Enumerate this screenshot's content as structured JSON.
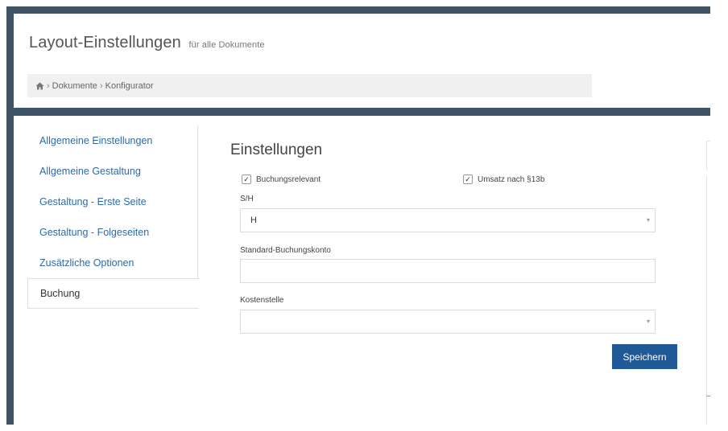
{
  "header": {
    "title": "Layout-Einstellungen",
    "subtitle": "für alle Dokumente",
    "breadcrumb": {
      "home_icon": "home-icon",
      "separator": "›",
      "items": [
        "Dokumente",
        "Konfigurator"
      ]
    }
  },
  "sidebar": {
    "items": [
      {
        "label": "Allgemeine Einstellungen"
      },
      {
        "label": "Allgemeine Gestaltung"
      },
      {
        "label": "Gestaltung - Erste Seite"
      },
      {
        "label": "Gestaltung - Folgeseiten"
      },
      {
        "label": "Zusätzliche Optionen"
      },
      {
        "label": "Buchung"
      }
    ],
    "active_item": "Buchung"
  },
  "main": {
    "section_title": "Einstellungen",
    "checkboxes": [
      {
        "label": "Buchungsrelevant",
        "checked": true,
        "mark": "✓"
      },
      {
        "label": "Umsatz nach §13b",
        "checked": true,
        "mark": "✓"
      }
    ],
    "fields": {
      "sh": {
        "label": "S/H",
        "value": "H",
        "caret": "▾"
      },
      "konto": {
        "label": "Standard-Buchungskonto",
        "value": ""
      },
      "kostenstelle": {
        "label": "Kostenstelle",
        "value": "",
        "caret": "▾"
      }
    },
    "save_label": "Speichern"
  },
  "colors": {
    "frame": "#3f5466",
    "link": "#2f6aa7",
    "primary_button": "#1f5a96",
    "breadcrumb_bg": "#f0f0f0"
  }
}
